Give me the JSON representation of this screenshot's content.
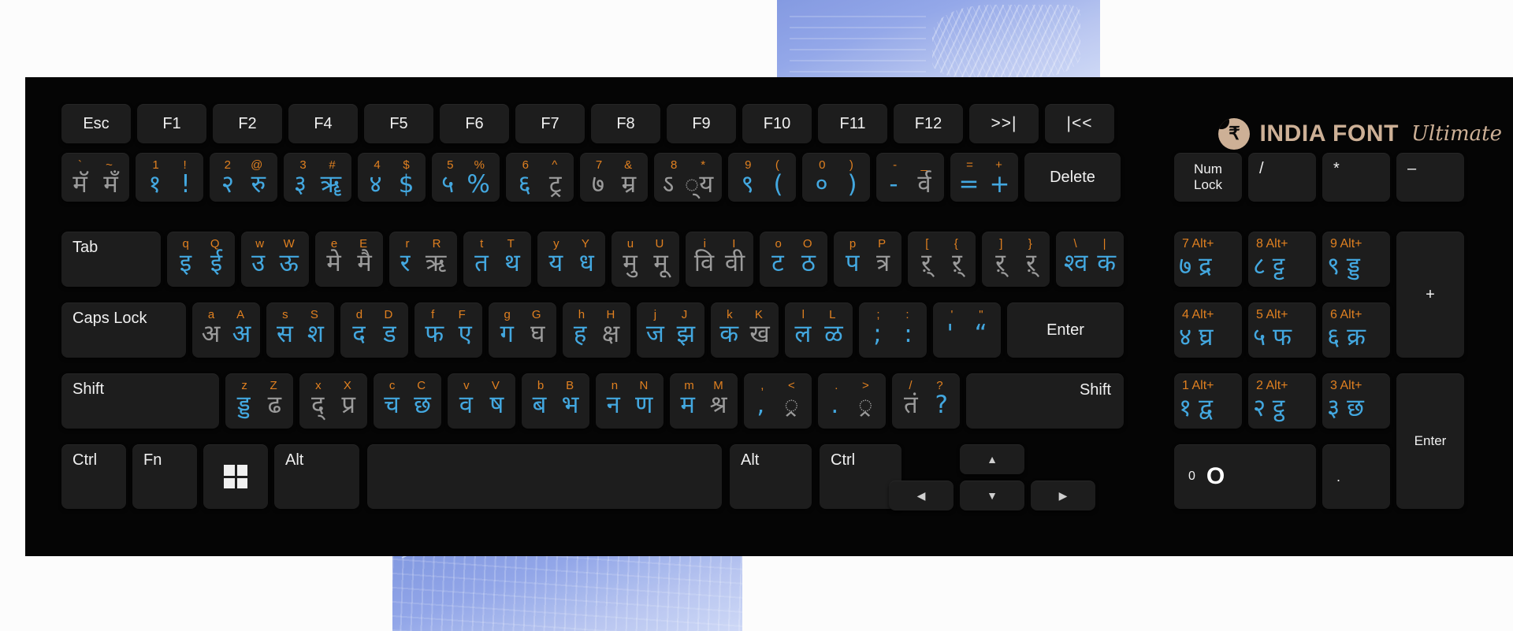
{
  "brand": {
    "mark": "rupee-logo-icon",
    "name": "INDIA FONT",
    "sub": "Ultimate"
  },
  "colors": {
    "keyboard_bg": "#050505",
    "key_bg": "#1d1d1d",
    "legend_orange": "#e08020",
    "deva_blue": "#43a8e0",
    "deva_grey": "#9b9b9b",
    "key_text": "#f2f2f2",
    "brand_tan": "#cdb096",
    "page_bg": "#fcfcfc",
    "art_blue": "#7e95e0"
  },
  "rows": {
    "function_row": [
      {
        "label": "Esc"
      },
      {
        "label": "F1"
      },
      {
        "label": "F2"
      },
      {
        "label": "F4"
      },
      {
        "label": "F5"
      },
      {
        "label": "F6"
      },
      {
        "label": "F7"
      },
      {
        "label": "F8"
      },
      {
        "label": "F9"
      },
      {
        "label": "F10"
      },
      {
        "label": "F11"
      },
      {
        "label": "F12"
      },
      {
        "label": ">>|"
      },
      {
        "label": "|<<"
      }
    ],
    "number_row": [
      {
        "legend": [
          "`",
          "~"
        ],
        "deva": [
          "मॅ",
          "मँ"
        ],
        "deva_colors": [
          "grey",
          "grey"
        ]
      },
      {
        "legend": [
          "1",
          "!"
        ],
        "deva": [
          "१",
          "!"
        ],
        "deva_colors": [
          "blue",
          "blue"
        ]
      },
      {
        "legend": [
          "2",
          "@"
        ],
        "deva": [
          "२",
          "रु"
        ],
        "deva_colors": [
          "blue",
          "blue"
        ]
      },
      {
        "legend": [
          "3",
          "#"
        ],
        "deva": [
          "३",
          "ॠ"
        ],
        "deva_colors": [
          "blue",
          "blue"
        ]
      },
      {
        "legend": [
          "4",
          "$"
        ],
        "deva": [
          "४",
          "$"
        ],
        "deva_colors": [
          "blue",
          "blue"
        ]
      },
      {
        "legend": [
          "5",
          "%"
        ],
        "deva": [
          "५",
          "%"
        ],
        "deva_colors": [
          "blue",
          "blue"
        ]
      },
      {
        "legend": [
          "6",
          "^"
        ],
        "deva": [
          "६",
          "ट्र"
        ],
        "deva_colors": [
          "blue",
          "grey"
        ]
      },
      {
        "legend": [
          "7",
          "&"
        ],
        "deva": [
          "७",
          "म्र"
        ],
        "deva_colors": [
          "grey",
          "grey"
        ]
      },
      {
        "legend": [
          "8",
          "*"
        ],
        "deva": [
          "ऽ",
          "्य"
        ],
        "deva_colors": [
          "grey",
          "grey"
        ]
      },
      {
        "legend": [
          "9",
          "("
        ],
        "deva": [
          "९",
          "("
        ],
        "deva_colors": [
          "blue",
          "blue"
        ]
      },
      {
        "legend": [
          "0",
          ")"
        ],
        "deva": [
          "०",
          ")"
        ],
        "deva_colors": [
          "blue",
          "blue"
        ]
      },
      {
        "legend": [
          "-",
          "_"
        ],
        "deva": [
          "-",
          "र्व"
        ],
        "deva_colors": [
          "blue",
          "grey"
        ]
      },
      {
        "legend": [
          "=",
          "+"
        ],
        "deva": [
          "=",
          "+"
        ],
        "deva_colors": [
          "blue",
          "blue"
        ]
      },
      {
        "label": "Delete"
      }
    ],
    "qwerty_row": [
      {
        "label": "Tab"
      },
      {
        "legend": [
          "q",
          "Q"
        ],
        "deva": [
          "इ",
          "ई"
        ],
        "deva_colors": [
          "blue",
          "blue"
        ]
      },
      {
        "legend": [
          "w",
          "W"
        ],
        "deva": [
          "उ",
          "ऊ"
        ],
        "deva_colors": [
          "blue",
          "blue"
        ]
      },
      {
        "legend": [
          "e",
          "E"
        ],
        "deva": [
          "मे",
          "मै"
        ],
        "deva_colors": [
          "grey",
          "grey"
        ]
      },
      {
        "legend": [
          "r",
          "R"
        ],
        "deva": [
          "र",
          "ऋ"
        ],
        "deva_colors": [
          "blue",
          "grey"
        ]
      },
      {
        "legend": [
          "t",
          "T"
        ],
        "deva": [
          "त",
          "थ"
        ],
        "deva_colors": [
          "blue",
          "blue"
        ]
      },
      {
        "legend": [
          "y",
          "Y"
        ],
        "deva": [
          "य",
          "ध"
        ],
        "deva_colors": [
          "blue",
          "blue"
        ]
      },
      {
        "legend": [
          "u",
          "U"
        ],
        "deva": [
          "मु",
          "मू"
        ],
        "deva_colors": [
          "grey",
          "grey"
        ]
      },
      {
        "legend": [
          "i",
          "I"
        ],
        "deva": [
          "वि",
          "वी"
        ],
        "deva_colors": [
          "grey",
          "grey"
        ]
      },
      {
        "legend": [
          "o",
          "O"
        ],
        "deva": [
          "ट",
          "ठ"
        ],
        "deva_colors": [
          "blue",
          "blue"
        ]
      },
      {
        "legend": [
          "p",
          "P"
        ],
        "deva": [
          "प",
          "त्र"
        ],
        "deva_colors": [
          "blue",
          "grey"
        ]
      },
      {
        "legend": [
          "[",
          "{"
        ],
        "deva": [
          "ऱ्",
          "ऱ्"
        ],
        "deva_colors": [
          "grey",
          "grey"
        ]
      },
      {
        "legend": [
          "]",
          "}"
        ],
        "deva": [
          "ऱ्",
          "ऱ्"
        ],
        "deva_colors": [
          "grey",
          "grey"
        ]
      },
      {
        "legend": [
          "\\",
          "|"
        ],
        "deva": [
          "श्व",
          "क"
        ],
        "deva_colors": [
          "blue",
          "blue"
        ]
      }
    ],
    "home_row": [
      {
        "label": "Caps Lock"
      },
      {
        "legend": [
          "a",
          "A"
        ],
        "deva": [
          "अ",
          "अ"
        ],
        "deva_colors": [
          "grey",
          "blue"
        ]
      },
      {
        "legend": [
          "s",
          "S"
        ],
        "deva": [
          "स",
          "श"
        ],
        "deva_colors": [
          "blue",
          "blue"
        ]
      },
      {
        "legend": [
          "d",
          "D"
        ],
        "deva": [
          "द",
          "ड"
        ],
        "deva_colors": [
          "blue",
          "blue"
        ]
      },
      {
        "legend": [
          "f",
          "F"
        ],
        "deva": [
          "फ",
          "ए"
        ],
        "deva_colors": [
          "blue",
          "blue"
        ]
      },
      {
        "legend": [
          "g",
          "G"
        ],
        "deva": [
          "ग",
          "घ"
        ],
        "deva_colors": [
          "blue",
          "grey"
        ]
      },
      {
        "legend": [
          "h",
          "H"
        ],
        "deva": [
          "ह",
          "क्ष"
        ],
        "deva_colors": [
          "blue",
          "grey"
        ]
      },
      {
        "legend": [
          "j",
          "J"
        ],
        "deva": [
          "ज",
          "झ"
        ],
        "deva_colors": [
          "blue",
          "blue"
        ]
      },
      {
        "legend": [
          "k",
          "K"
        ],
        "deva": [
          "क",
          "ख"
        ],
        "deva_colors": [
          "blue",
          "grey"
        ]
      },
      {
        "legend": [
          "l",
          "L"
        ],
        "deva": [
          "ल",
          "ळ"
        ],
        "deva_colors": [
          "blue",
          "blue"
        ]
      },
      {
        "legend": [
          ";",
          ":"
        ],
        "deva": [
          ";",
          ":"
        ],
        "deva_colors": [
          "blue",
          "blue"
        ]
      },
      {
        "legend": [
          "'",
          "\""
        ],
        "deva": [
          "'",
          "“"
        ],
        "deva_colors": [
          "blue",
          "blue"
        ]
      },
      {
        "label": "Enter"
      }
    ],
    "shift_row": [
      {
        "label": "Shift"
      },
      {
        "legend": [
          "z",
          "Z"
        ],
        "deva": [
          "ड्ड",
          "ढ"
        ],
        "deva_colors": [
          "blue",
          "grey"
        ]
      },
      {
        "legend": [
          "x",
          "X"
        ],
        "deva": [
          "द्",
          "प्र"
        ],
        "deva_colors": [
          "grey",
          "grey"
        ]
      },
      {
        "legend": [
          "c",
          "C"
        ],
        "deva": [
          "च",
          "छ"
        ],
        "deva_colors": [
          "blue",
          "blue"
        ]
      },
      {
        "legend": [
          "v",
          "V"
        ],
        "deva": [
          "व",
          "ष"
        ],
        "deva_colors": [
          "blue",
          "blue"
        ]
      },
      {
        "legend": [
          "b",
          "B"
        ],
        "deva": [
          "ब",
          "भ"
        ],
        "deva_colors": [
          "blue",
          "blue"
        ]
      },
      {
        "legend": [
          "n",
          "N"
        ],
        "deva": [
          "न",
          "ण"
        ],
        "deva_colors": [
          "blue",
          "blue"
        ]
      },
      {
        "legend": [
          "m",
          "M"
        ],
        "deva": [
          "म",
          "श्र"
        ],
        "deva_colors": [
          "blue",
          "grey"
        ]
      },
      {
        "legend": [
          ",",
          "<"
        ],
        "deva": [
          ",",
          "्र"
        ],
        "deva_colors": [
          "blue",
          "grey"
        ]
      },
      {
        "legend": [
          ".",
          ">"
        ],
        "deva": [
          ".",
          "्र"
        ],
        "deva_colors": [
          "blue",
          "grey"
        ]
      },
      {
        "legend": [
          "/",
          "?"
        ],
        "deva": [
          "तं",
          "?"
        ],
        "deva_colors": [
          "grey",
          "blue"
        ]
      },
      {
        "label": "Shift"
      }
    ],
    "bottom_row": [
      {
        "label": "Ctrl"
      },
      {
        "label": "Fn"
      },
      {
        "label": "windows-icon",
        "icon": "windows-icon"
      },
      {
        "label": "Alt"
      },
      {
        "label": ""
      },
      {
        "label": "Alt"
      },
      {
        "label": "Ctrl"
      }
    ],
    "arrow_keys": {
      "up": "▲",
      "left": "◀",
      "down": "▼",
      "right": "▶"
    }
  },
  "numpad": {
    "row1": [
      {
        "label": "Num\nLock",
        "line1": "Num",
        "line2": "Lock"
      },
      {
        "label": "/"
      },
      {
        "label": "*"
      },
      {
        "label": "–"
      }
    ],
    "row2": [
      {
        "top": "7 Alt+",
        "deva": [
          "७",
          "द्र"
        ]
      },
      {
        "top": "8 Alt+",
        "deva": [
          "८",
          "ट्ट"
        ]
      },
      {
        "top": "9 Alt+",
        "deva": [
          "९",
          "ड्ड"
        ]
      }
    ],
    "plus": "+",
    "row3": [
      {
        "top": "4 Alt+",
        "deva": [
          "४",
          "घ्र"
        ]
      },
      {
        "top": "5 Alt+",
        "deva": [
          "५",
          "फ"
        ]
      },
      {
        "top": "6 Alt+",
        "deva": [
          "६",
          "क्र"
        ]
      }
    ],
    "row4": [
      {
        "top": "1 Alt+",
        "deva": [
          "१",
          "द्व"
        ]
      },
      {
        "top": "2 Alt+",
        "deva": [
          "२",
          "ट्ठ"
        ]
      },
      {
        "top": "3 Alt+",
        "deva": [
          "३",
          "छ"
        ]
      }
    ],
    "enter": "Enter",
    "zero": {
      "small": "0",
      "big": "O"
    },
    "dot": "."
  }
}
